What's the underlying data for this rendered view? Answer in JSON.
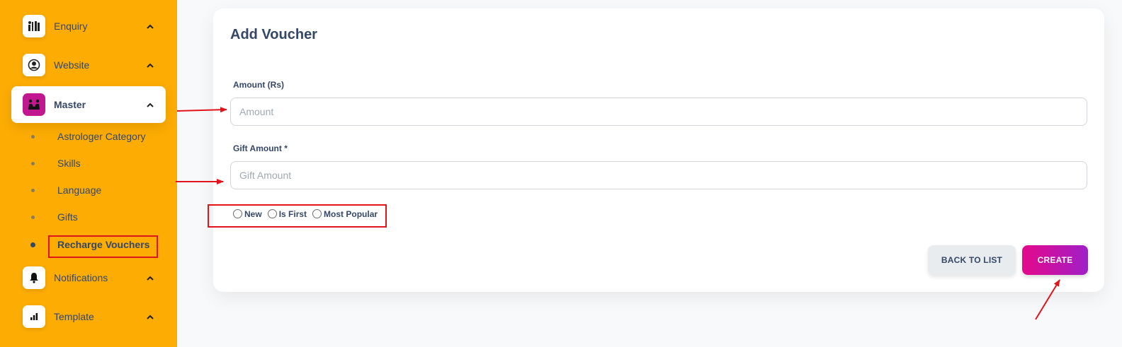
{
  "sidebar": {
    "items": [
      {
        "label": "Enquiry",
        "icon": "enquiry-icon"
      },
      {
        "label": "Website",
        "icon": "website-icon"
      },
      {
        "label": "Master",
        "icon": "master-icon"
      },
      {
        "label": "Notifications",
        "icon": "bell-icon"
      },
      {
        "label": "Template",
        "icon": "chart-icon"
      }
    ],
    "master_subitems": [
      "Astrologer Category",
      "Skills",
      "Language",
      "Gifts",
      "Recharge Vouchers"
    ]
  },
  "form": {
    "title": "Add Voucher",
    "amount_label": "Amount (Rs)",
    "amount_placeholder": "Amount",
    "gift_label": "Gift Amount *",
    "gift_placeholder": "Gift Amount",
    "radios": [
      "New",
      "Is First",
      "Most Popular"
    ],
    "back_label": "BACK TO LIST",
    "create_label": "CREATE"
  },
  "colors": {
    "sidebar_bg": "#fdac03",
    "accent": "#c2188f",
    "annotation": "#e0141a"
  }
}
